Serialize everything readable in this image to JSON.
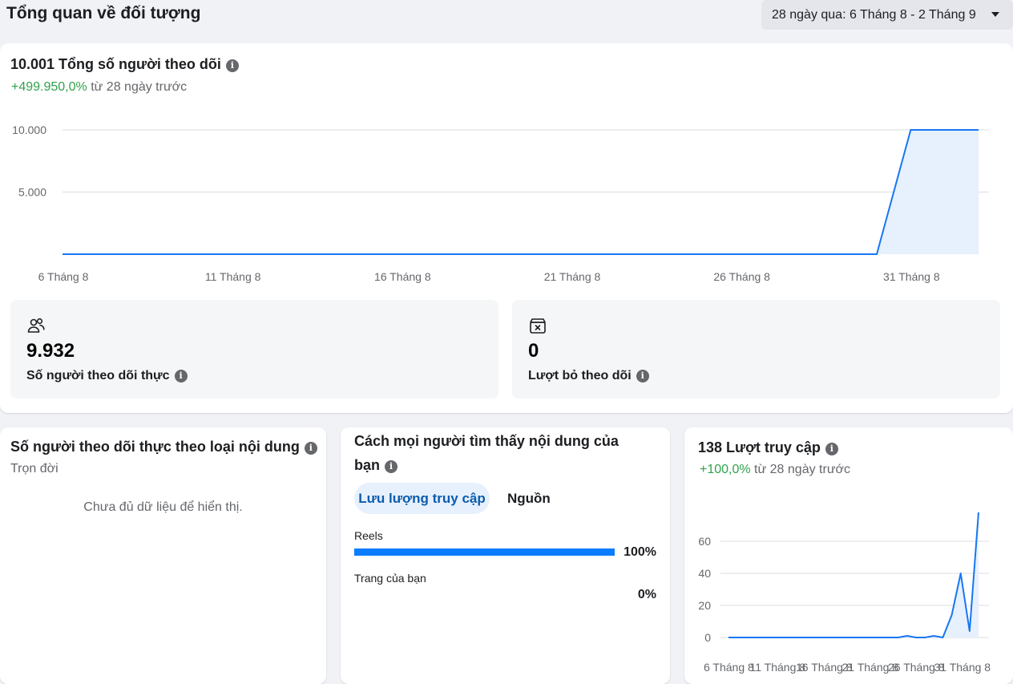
{
  "header": {
    "title": "Tổng quan về đối tượng",
    "date_range": "28 ngày qua: 6 Tháng 8 - 2 Tháng 9"
  },
  "followers": {
    "title": "10.001 Tổng số người theo dõi",
    "change": "+499.950,0%",
    "change_suffix": " từ 28 ngày trước"
  },
  "net_followers": {
    "value": "9.932",
    "label": "Số người theo dõi thực",
    "icon": "people-icon"
  },
  "unfollows": {
    "value": "0",
    "label": "Lượt bỏ theo dõi",
    "icon": "unfollow-icon"
  },
  "by_content": {
    "title": "Số người theo dõi thực theo loại nội dung",
    "subtitle": "Trọn đời",
    "empty": "Chưa đủ dữ liệu để hiển thị."
  },
  "discovery": {
    "title_line1": "Cách mọi người tìm thấy nội dung của",
    "title_line2": "bạn",
    "tabs": [
      "Lưu lượng truy cập",
      "Nguồn"
    ],
    "sources": [
      {
        "label": "Reels",
        "percent": "100%",
        "fraction": 1.0
      },
      {
        "label": "Trang của bạn",
        "percent": "0%",
        "fraction": 0.0
      }
    ]
  },
  "visits": {
    "title": "138 Lượt truy cập",
    "change": "+100,0%",
    "change_suffix": " từ 28 ngày trước"
  },
  "colors": {
    "line": "#1877f2",
    "area": "#e7f0fd",
    "positive": "#31a24c",
    "bar": "#0a7cff"
  },
  "chart_data": [
    {
      "type": "area",
      "title": "",
      "x": [
        "6 Tháng 8",
        "7 Tháng 8",
        "8 Tháng 8",
        "9 Tháng 8",
        "10 Tháng 8",
        "11 Tháng 8",
        "12 Tháng 8",
        "13 Tháng 8",
        "14 Tháng 8",
        "15 Tháng 8",
        "16 Tháng 8",
        "17 Tháng 8",
        "18 Tháng 8",
        "19 Tháng 8",
        "20 Tháng 8",
        "21 Tháng 8",
        "22 Tháng 8",
        "23 Tháng 8",
        "24 Tháng 8",
        "25 Tháng 8",
        "26 Tháng 8",
        "27 Tháng 8",
        "28 Tháng 8",
        "29 Tháng 8",
        "30 Tháng 8",
        "31 Tháng 8",
        "1 Tháng 9",
        "2 Tháng 9"
      ],
      "values": [
        0,
        0,
        0,
        0,
        0,
        0,
        0,
        0,
        0,
        0,
        0,
        0,
        0,
        0,
        0,
        0,
        0,
        0,
        0,
        0,
        0,
        0,
        0,
        0,
        0,
        10000,
        10000,
        10000
      ],
      "xticks": [
        "6 Tháng 8",
        "11 Tháng 8",
        "16 Tháng 8",
        "21 Tháng 8",
        "26 Tháng 8",
        "31 Tháng 8"
      ],
      "yticks": [
        "5.000",
        "10.000"
      ],
      "ytick_values": [
        5000,
        10000
      ],
      "ylim": [
        0,
        10000
      ]
    },
    {
      "type": "line",
      "title": "",
      "x": [
        "6 Tháng 8",
        "7 Tháng 8",
        "8 Tháng 8",
        "9 Tháng 8",
        "10 Tháng 8",
        "11 Tháng 8",
        "12 Tháng 8",
        "13 Tháng 8",
        "14 Tháng 8",
        "15 Tháng 8",
        "16 Tháng 8",
        "17 Tháng 8",
        "18 Tháng 8",
        "19 Tháng 8",
        "20 Tháng 8",
        "21 Tháng 8",
        "22 Tháng 8",
        "23 Tháng 8",
        "24 Tháng 8",
        "25 Tháng 8",
        "26 Tháng 8",
        "27 Tháng 8",
        "28 Tháng 8",
        "29 Tháng 8",
        "30 Tháng 8",
        "31 Tháng 8",
        "1 Tháng 9",
        "2 Tháng 9"
      ],
      "values": [
        0,
        0,
        0,
        0,
        0,
        0,
        0,
        0,
        0,
        0,
        0,
        0,
        0,
        0,
        0,
        0,
        0,
        0,
        0,
        0,
        1,
        0,
        0,
        1,
        0,
        14,
        40,
        4,
        78
      ],
      "xticks": [
        "6 Tháng 8",
        "11 Tháng 8",
        "16 Tháng 8",
        "21 Tháng 8",
        "26 Tháng 8",
        "31 Tháng 8"
      ],
      "yticks": [
        "0",
        "20",
        "40",
        "60"
      ],
      "ytick_values": [
        0,
        20,
        40,
        60
      ],
      "ylim": [
        0,
        80
      ]
    }
  ]
}
